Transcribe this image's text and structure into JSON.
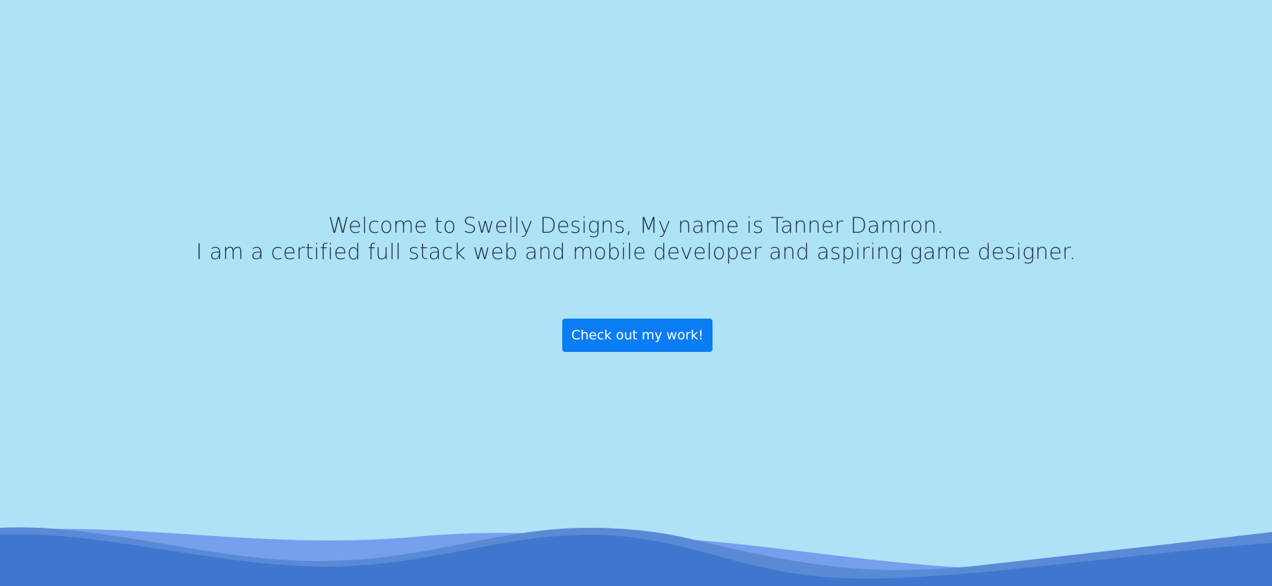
{
  "hero": {
    "line1": "Welcome to Swelly Designs, My name is Tanner Damron.",
    "line2": "I am a certified full stack web and mobile developer and aspiring game designer.",
    "cta_label": "Check out my work!"
  },
  "colors": {
    "background": "#aee2f6",
    "text": "#1f2f3d",
    "button": "#0a7cf4",
    "wave_back": "#74a0ee",
    "wave_mid": "#5a8ad6",
    "wave_front": "#3f77cf"
  }
}
